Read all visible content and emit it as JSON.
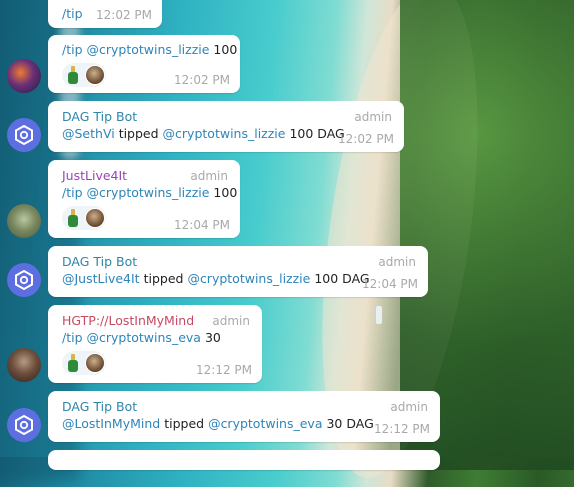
{
  "colors": {
    "link": "#2d85b8",
    "name_blue": "#2f86a8",
    "name_purple": "#9a43b7",
    "name_red": "#c64a62",
    "meta_gray": "#a9a9a9",
    "bubble_bg": "#ffffff",
    "bot_avatar_bg": "#5c6ee0"
  },
  "icons": {
    "reaction_emoji": "bottle-icon",
    "reaction_user": "user-avatar",
    "bot_avatar": "hexagon-logo-icon"
  },
  "messages": [
    {
      "id": "m0",
      "text": "/tip",
      "time": "12:02 PM"
    },
    {
      "id": "m1",
      "command": "/tip",
      "mention": "@cryptotwins_lizzie",
      "amount": "100",
      "time": "12:02 PM"
    },
    {
      "id": "m2",
      "name": "DAG Tip Bot",
      "role": "admin",
      "sender": "@SethVi",
      "verb": "tipped",
      "recipient": "@cryptotwins_lizzie",
      "amount": "100 DAG",
      "time": "12:02 PM"
    },
    {
      "id": "m3",
      "name": "JustLive4It",
      "role": "admin",
      "command": "/tip",
      "mention": "@cryptotwins_lizzie",
      "amount": "100",
      "time": "12:04 PM"
    },
    {
      "id": "m4",
      "name": "DAG Tip Bot",
      "role": "admin",
      "sender": "@JustLive4It",
      "verb": "tipped",
      "recipient": "@cryptotwins_lizzie",
      "amount": "100 DAG",
      "time": "12:04 PM"
    },
    {
      "id": "m5",
      "name": "HGTP://LostInMyMind",
      "role": "admin",
      "command": "/tip",
      "mention": "@cryptotwins_eva",
      "amount": "30",
      "time": "12:12 PM"
    },
    {
      "id": "m6",
      "name": "DAG Tip Bot",
      "role": "admin",
      "sender": "@LostInMyMind",
      "verb": "tipped",
      "recipient": "@cryptotwins_eva",
      "amount": "30 DAG",
      "time": "12:12 PM"
    }
  ]
}
